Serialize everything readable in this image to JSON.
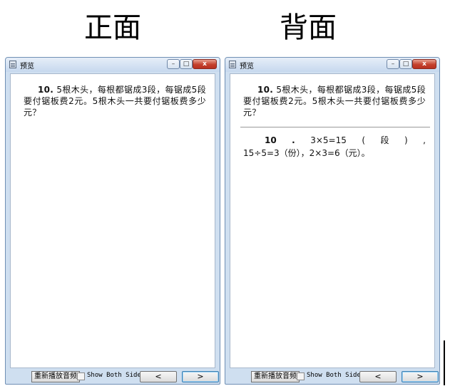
{
  "headings": {
    "front": "正面",
    "back": "背面"
  },
  "window": {
    "title": "预览",
    "min_glyph": "–",
    "max_glyph": "□",
    "close_glyph": "x"
  },
  "card": {
    "number": "10.",
    "question": "5根木头，每根都锯成3段，每锯成5段要付锯板费2元。5根木头一共要付锯板费多少元？",
    "answer_number": "10",
    "answer_dot": ".",
    "answer_expr1": "3×5=15",
    "answer_paren_open": "(",
    "answer_unit": "段",
    "answer_paren_close": ")",
    "answer_comma": ",",
    "answer_line2": "15÷5=3（份），2×3=6（元）。"
  },
  "controls": {
    "replay_label": "重新播放音频",
    "show_both_label": "Show Both Sides",
    "prev_label": "<",
    "next_label": ">"
  }
}
